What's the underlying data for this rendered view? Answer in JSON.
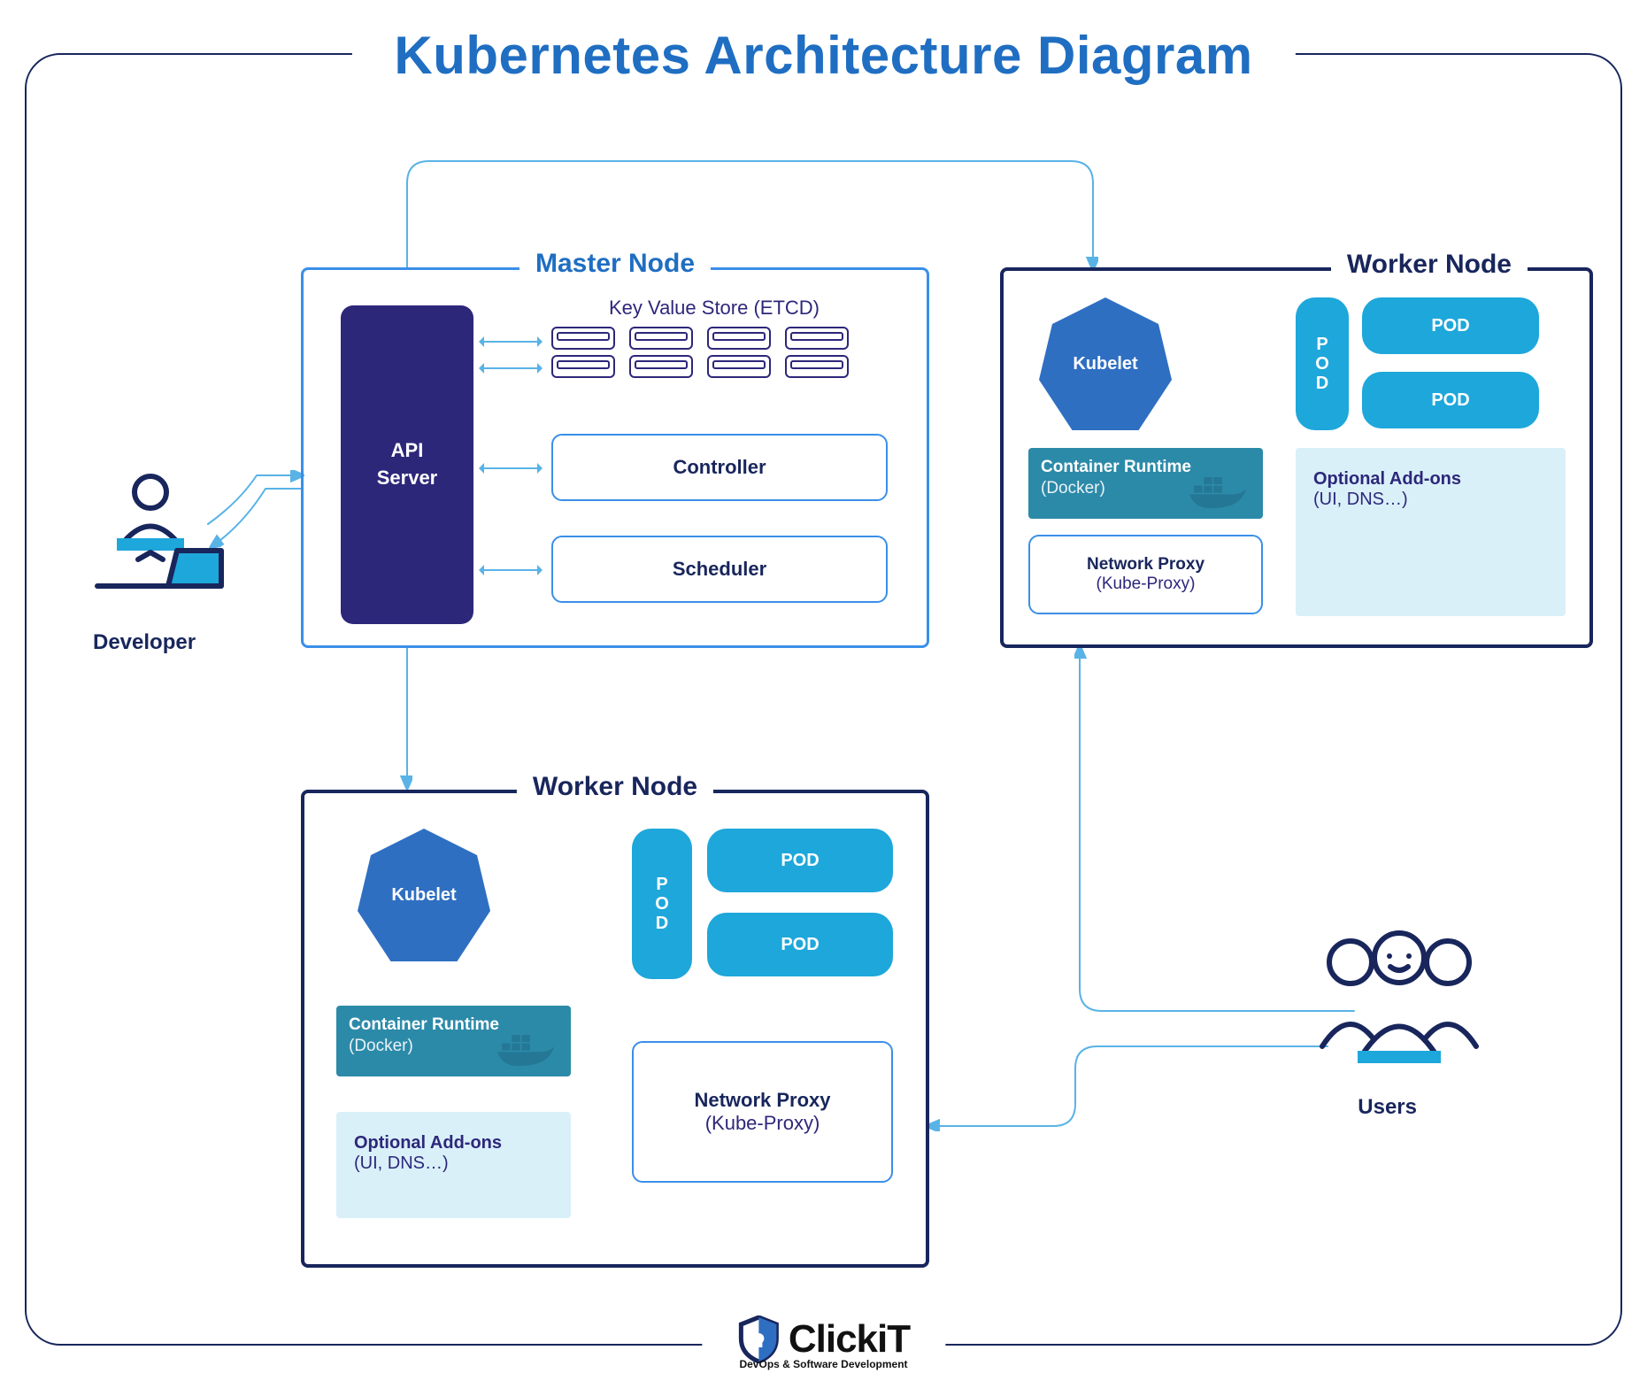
{
  "title": "Kubernetes Architecture Diagram",
  "actors": {
    "developer": "Developer",
    "users": "Users"
  },
  "master": {
    "label": "Master Node",
    "api": "API\nServer",
    "etcd_label": "Key Value Store (ETCD)",
    "controller": "Controller",
    "scheduler": "Scheduler"
  },
  "worker": {
    "label": "Worker Node",
    "kubelet": "Kubelet",
    "runtime_title": "Container Runtime",
    "runtime_sub": "(Docker)",
    "netproxy_title": "Network Proxy",
    "netproxy_sub": "(Kube-Proxy)",
    "addons_title": "Optional Add-ons",
    "addons_sub": "(UI, DNS…)",
    "pod": "POD",
    "pod_v": "P\nO\nD"
  },
  "branding": {
    "name": "ClickiT",
    "tagline": "DevOps & Software Development"
  }
}
